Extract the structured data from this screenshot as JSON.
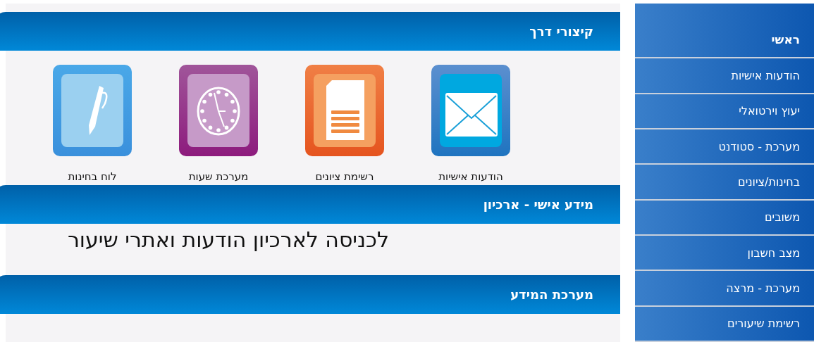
{
  "sidebar": {
    "items": [
      {
        "label": "ראשי",
        "selected": true
      },
      {
        "label": "הודעות אישיות",
        "selected": false
      },
      {
        "label": "יעוץ וירטואלי",
        "selected": false
      },
      {
        "label": "מערכת - סטודנט",
        "selected": false
      },
      {
        "label": "בחינות/ציונים",
        "selected": false
      },
      {
        "label": "משובים",
        "selected": false
      },
      {
        "label": "מצב חשבון",
        "selected": false
      },
      {
        "label": "מערכת - מרצה",
        "selected": false
      },
      {
        "label": "רשימת שיעורים",
        "selected": false
      }
    ]
  },
  "panels": [
    {
      "title": "קיצורי דרך",
      "kind": "shortcuts",
      "shortcuts": [
        {
          "label": "הודעות אישיות",
          "kind": "mail"
        },
        {
          "label": "רשימת ציונים",
          "kind": "document"
        },
        {
          "label": "מערכת שעות",
          "kind": "clock"
        },
        {
          "label": "לוח בחינות",
          "kind": "pen"
        }
      ]
    },
    {
      "title": "מידע אישי - ארכיון",
      "kind": "link",
      "text": "לכניסה לארכיון הודעות ואתרי שיעור"
    },
    {
      "title": "מערכת המידע",
      "kind": "empty"
    }
  ]
}
